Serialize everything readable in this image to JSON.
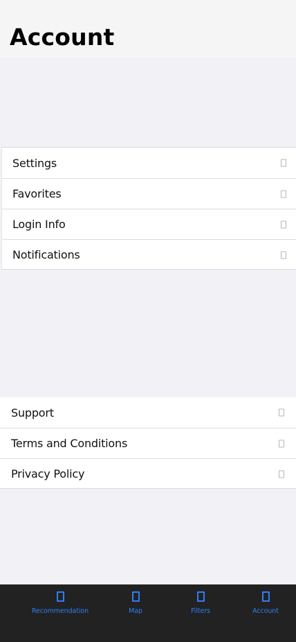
{
  "header": {
    "title": "Account"
  },
  "groups": [
    {
      "items": [
        {
          "label": "Settings",
          "icon": "chevron-right-icon"
        },
        {
          "label": "Favorites",
          "icon": "chevron-right-icon"
        },
        {
          "label": "Login Info",
          "icon": "chevron-right-icon"
        },
        {
          "label": "Notifications",
          "icon": "chevron-right-icon"
        }
      ]
    },
    {
      "items": [
        {
          "label": "Support",
          "icon": "chevron-right-icon"
        },
        {
          "label": "Terms and Conditions",
          "icon": "chevron-right-icon"
        },
        {
          "label": "Privacy Policy",
          "icon": "chevron-right-icon"
        }
      ]
    }
  ],
  "tabbar": {
    "tabs": [
      {
        "label": "Recommendation",
        "icon": "recommendation-icon"
      },
      {
        "label": "Map",
        "icon": "map-icon"
      },
      {
        "label": "Filters",
        "icon": "filters-icon"
      },
      {
        "label": "Account",
        "icon": "account-icon"
      }
    ]
  },
  "colors": {
    "background": "#f2f2f6",
    "header_background": "#f5f5f5",
    "tabbar_background": "#222222",
    "accent": "#2f7ff5"
  }
}
